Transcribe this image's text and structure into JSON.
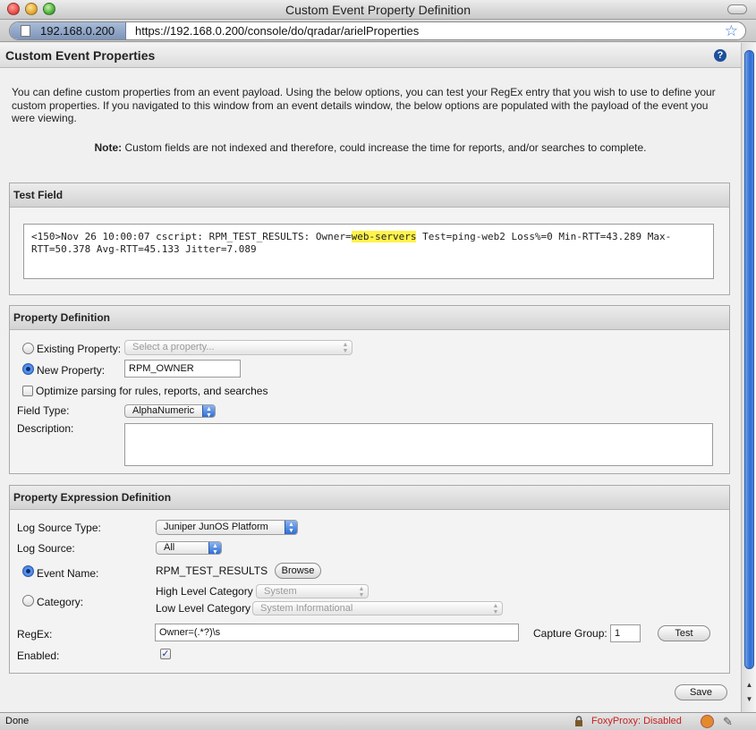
{
  "window": {
    "title": "Custom Event Property Definition"
  },
  "urlbar": {
    "site": "192.168.0.200",
    "url": "https://192.168.0.200/console/do/qradar/arielProperties"
  },
  "page": {
    "title": "Custom Event Properties",
    "intro": "You can define custom properties from an event payload. Using the below options, you can test your RegEx entry that you wish to use to define your custom properties. If you navigated to this window from an event details window, the below options are populated with the payload of the event you were viewing.",
    "note_label": "Note:",
    "note_text": " Custom fields are not indexed and therefore, could increase the time for reports, and/or searches to complete."
  },
  "test_field": {
    "heading": "Test Field",
    "payload_before": "<150>Nov 26 10:00:07 cscript: RPM_TEST_RESULTS: Owner=",
    "payload_highlight": "web-servers",
    "payload_after": " Test=ping-web2 Loss%=0 Min-RTT=43.289 Max-RTT=50.378 Avg-RTT=45.133 Jitter=7.089"
  },
  "property_definition": {
    "heading": "Property Definition",
    "existing_label": "Existing Property:",
    "existing_placeholder": "Select a property...",
    "new_label": "New Property:",
    "new_value": "RPM_OWNER",
    "optimize_label": "Optimize parsing for rules, reports, and searches",
    "field_type_label": "Field Type:",
    "field_type_value": "AlphaNumeric",
    "description_label": "Description:"
  },
  "expression": {
    "heading": "Property Expression Definition",
    "log_source_type_label": "Log Source Type:",
    "log_source_type_value": "Juniper JunOS Platform",
    "log_source_label": "Log Source:",
    "log_source_value": "All",
    "event_name_label": "Event Name:",
    "event_name_value": "RPM_TEST_RESULTS",
    "browse_label": "Browse",
    "category_label": "Category:",
    "high_level_label": "High Level Category",
    "high_level_value": "System",
    "low_level_label": "Low Level Category",
    "low_level_value": "System Informational",
    "regex_label": "RegEx:",
    "regex_value": "Owner=(.*?)\\s",
    "capture_group_label": "Capture Group:",
    "capture_group_value": "1",
    "test_label": "Test",
    "enabled_label": "Enabled:"
  },
  "footer": {
    "save_label": "Save"
  },
  "statusbar": {
    "status": "Done",
    "proxy": "FoxyProxy: Disabled"
  }
}
